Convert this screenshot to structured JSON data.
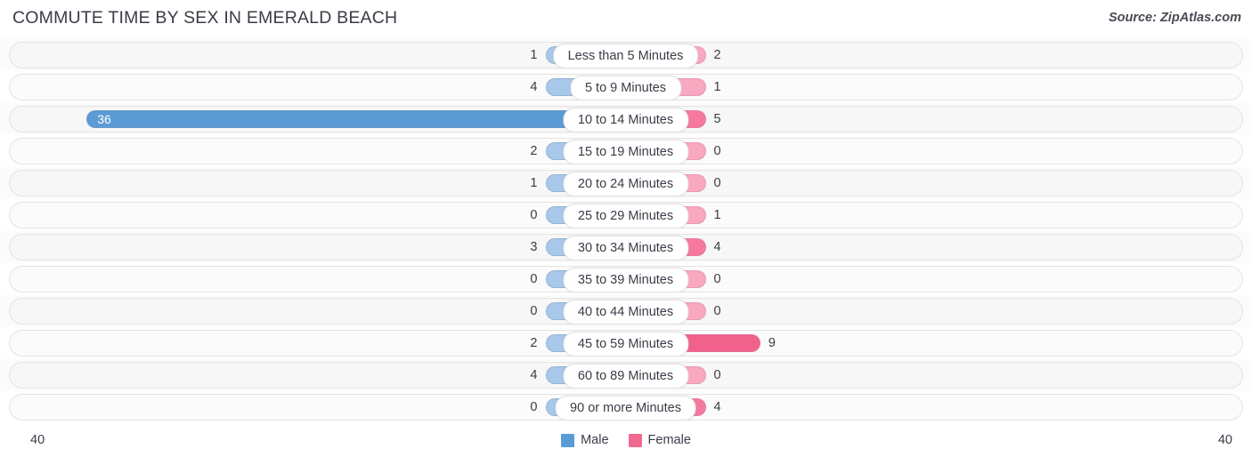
{
  "header": {
    "title": "COMMUTE TIME BY SEX IN EMERALD BEACH",
    "source": "Source: ZipAtlas.com"
  },
  "legend": {
    "male_label": "Male",
    "female_label": "Female",
    "male_color": "#5b9bd5",
    "female_color": "#f2698f"
  },
  "axis": {
    "left_end": "40",
    "right_end": "40",
    "max": 40
  },
  "colors": {
    "male_strong": "#5b9bd5",
    "male_light": "#a8c8ea",
    "female_strong": "#f0628c",
    "female_mid": "#f5799f",
    "female_light": "#f8a8c0",
    "track_bg": "#f7f7f7",
    "track_border": "#e3e3e3",
    "gridline": "#d6d6d6",
    "text": "#3b3b47"
  },
  "chart_data": {
    "type": "bar",
    "orientation": "horizontal",
    "layout": "diverging-bidirectional",
    "title": "COMMUTE TIME BY SEX IN EMERALD BEACH",
    "xlabel": "",
    "ylabel": "",
    "xlim": [
      40,
      40
    ],
    "grid": true,
    "legend_position": "bottom-center",
    "categories": [
      "Less than 5 Minutes",
      "5 to 9 Minutes",
      "10 to 14 Minutes",
      "15 to 19 Minutes",
      "20 to 24 Minutes",
      "25 to 29 Minutes",
      "30 to 34 Minutes",
      "35 to 39 Minutes",
      "40 to 44 Minutes",
      "45 to 59 Minutes",
      "60 to 89 Minutes",
      "90 or more Minutes"
    ],
    "series": [
      {
        "name": "Male",
        "side": "left",
        "color": "#5b9bd5",
        "values": [
          1,
          4,
          36,
          2,
          1,
          0,
          3,
          0,
          0,
          2,
          4,
          0
        ]
      },
      {
        "name": "Female",
        "side": "right",
        "color": "#f2698f",
        "values": [
          2,
          1,
          5,
          0,
          0,
          1,
          4,
          0,
          0,
          9,
          0,
          4
        ]
      }
    ]
  },
  "rows": [
    {
      "label": "Less than 5 Minutes",
      "male": "1",
      "female": "2"
    },
    {
      "label": "5 to 9 Minutes",
      "male": "4",
      "female": "1"
    },
    {
      "label": "10 to 14 Minutes",
      "male": "36",
      "female": "5"
    },
    {
      "label": "15 to 19 Minutes",
      "male": "2",
      "female": "0"
    },
    {
      "label": "20 to 24 Minutes",
      "male": "1",
      "female": "0"
    },
    {
      "label": "25 to 29 Minutes",
      "male": "0",
      "female": "1"
    },
    {
      "label": "30 to 34 Minutes",
      "male": "3",
      "female": "4"
    },
    {
      "label": "35 to 39 Minutes",
      "male": "0",
      "female": "0"
    },
    {
      "label": "40 to 44 Minutes",
      "male": "0",
      "female": "0"
    },
    {
      "label": "45 to 59 Minutes",
      "male": "2",
      "female": "9"
    },
    {
      "label": "60 to 89 Minutes",
      "male": "4",
      "female": "0"
    },
    {
      "label": "90 or more Minutes",
      "male": "0",
      "female": "4"
    }
  ]
}
